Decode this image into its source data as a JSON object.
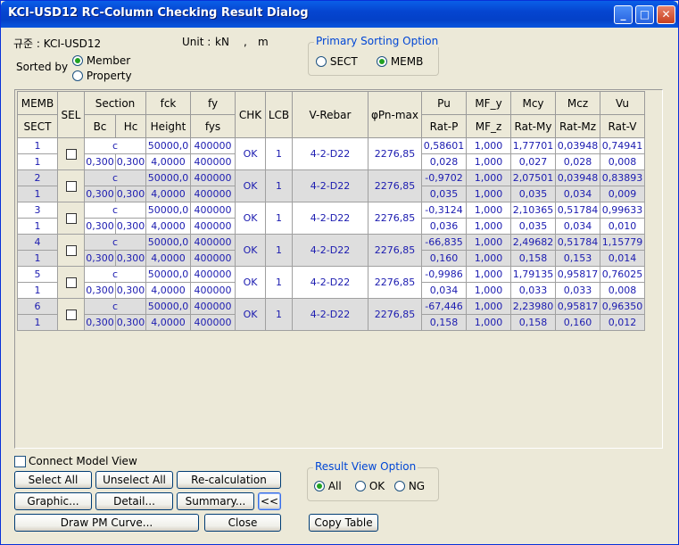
{
  "window": {
    "title": "KCI-USD12 RC-Column Checking Result Dialog",
    "min_icon": "minimize-icon",
    "max_icon": "maximize-icon",
    "close_icon": "close-icon"
  },
  "info": {
    "code_label": "규준 : KCI-USD12",
    "unit_label": "Unit :",
    "unit_force": "kN",
    "unit_sep": ",",
    "unit_length": "m"
  },
  "sorted_by": {
    "label": "Sorted by",
    "options": [
      {
        "label": "Member",
        "selected": true
      },
      {
        "label": "Property",
        "selected": false
      }
    ]
  },
  "primary_sorting": {
    "title": "Primary Sorting Option",
    "options": [
      {
        "label": "SECT",
        "selected": false
      },
      {
        "label": "MEMB",
        "selected": true
      }
    ]
  },
  "table": {
    "headers_top": [
      "MEMB",
      "SEL",
      "Section",
      "fck",
      "fy",
      "CHK",
      "LCB",
      "V-Rebar",
      "φPn-max",
      "Pu",
      "MF_y",
      "Mcy",
      "Mcz",
      "Vu"
    ],
    "headers_bottom": [
      "SECT",
      "Bc",
      "Hc",
      "Height",
      "fys",
      "Rat-P",
      "MF_z",
      "Rat-My",
      "Rat-Mz",
      "Rat-V"
    ],
    "rows": [
      {
        "memb": "1",
        "sect": "1",
        "shape": "c",
        "bc": "0,300",
        "hc": "0,300",
        "fck": "50000,0",
        "height": "4,0000",
        "fy": "400000",
        "fys": "400000",
        "chk": "OK",
        "lcb": "1",
        "rebar": "4-2-D22",
        "pn": "2276,85",
        "pu": "0,58601",
        "ratp": "0,028",
        "mfy": "1,000",
        "mfz": "1,000",
        "mcy": "1,77701",
        "ratmy": "0,027",
        "mcz": "0,03948",
        "ratmz": "0,028",
        "vu": "0,74941",
        "ratv": "0,008"
      },
      {
        "memb": "2",
        "sect": "1",
        "shape": "c",
        "bc": "0,300",
        "hc": "0,300",
        "fck": "50000,0",
        "height": "4,0000",
        "fy": "400000",
        "fys": "400000",
        "chk": "OK",
        "lcb": "1",
        "rebar": "4-2-D22",
        "pn": "2276,85",
        "pu": "-0,9702",
        "ratp": "0,035",
        "mfy": "1,000",
        "mfz": "1,000",
        "mcy": "2,07501",
        "ratmy": "0,035",
        "mcz": "0,03948",
        "ratmz": "0,034",
        "vu": "0,83893",
        "ratv": "0,009"
      },
      {
        "memb": "3",
        "sect": "1",
        "shape": "c",
        "bc": "0,300",
        "hc": "0,300",
        "fck": "50000,0",
        "height": "4,0000",
        "fy": "400000",
        "fys": "400000",
        "chk": "OK",
        "lcb": "1",
        "rebar": "4-2-D22",
        "pn": "2276,85",
        "pu": "-0,3124",
        "ratp": "0,036",
        "mfy": "1,000",
        "mfz": "1,000",
        "mcy": "2,10365",
        "ratmy": "0,035",
        "mcz": "0,51784",
        "ratmz": "0,034",
        "vu": "0,99633",
        "ratv": "0,010"
      },
      {
        "memb": "4",
        "sect": "1",
        "shape": "c",
        "bc": "0,300",
        "hc": "0,300",
        "fck": "50000,0",
        "height": "4,0000",
        "fy": "400000",
        "fys": "400000",
        "chk": "OK",
        "lcb": "1",
        "rebar": "4-2-D22",
        "pn": "2276,85",
        "pu": "-66,835",
        "ratp": "0,160",
        "mfy": "1,000",
        "mfz": "1,000",
        "mcy": "2,49682",
        "ratmy": "0,158",
        "mcz": "0,51784",
        "ratmz": "0,153",
        "vu": "1,15779",
        "ratv": "0,014"
      },
      {
        "memb": "5",
        "sect": "1",
        "shape": "c",
        "bc": "0,300",
        "hc": "0,300",
        "fck": "50000,0",
        "height": "4,0000",
        "fy": "400000",
        "fys": "400000",
        "chk": "OK",
        "lcb": "1",
        "rebar": "4-2-D22",
        "pn": "2276,85",
        "pu": "-0,9986",
        "ratp": "0,034",
        "mfy": "1,000",
        "mfz": "1,000",
        "mcy": "1,79135",
        "ratmy": "0,033",
        "mcz": "0,95817",
        "ratmz": "0,033",
        "vu": "0,76025",
        "ratv": "0,008"
      },
      {
        "memb": "6",
        "sect": "1",
        "shape": "c",
        "bc": "0,300",
        "hc": "0,300",
        "fck": "50000,0",
        "height": "4,0000",
        "fy": "400000",
        "fys": "400000",
        "chk": "OK",
        "lcb": "1",
        "rebar": "4-2-D22",
        "pn": "2276,85",
        "pu": "-67,446",
        "ratp": "0,158",
        "mfy": "1,000",
        "mfz": "1,000",
        "mcy": "2,23980",
        "ratmy": "0,158",
        "mcz": "0,95817",
        "ratmz": "0,160",
        "vu": "0,96350",
        "ratv": "0,012"
      }
    ]
  },
  "connect_model_view": {
    "label": "Connect Model View",
    "checked": false
  },
  "buttons": {
    "select_all": "Select All",
    "unselect_all": "Unselect All",
    "recalculation": "Re-calculation",
    "graphic": "Graphic...",
    "detail": "Detail...",
    "summary": "Summary...",
    "collapse": "<<",
    "draw_pm": "Draw PM Curve...",
    "close": "Close",
    "copy_table": "Copy Table"
  },
  "result_view": {
    "title": "Result View Option",
    "options": [
      {
        "label": "All",
        "selected": true
      },
      {
        "label": "OK",
        "selected": false
      },
      {
        "label": "NG",
        "selected": false
      }
    ]
  },
  "colors": {
    "title_bar": "#0545d0",
    "value_text": "#1b1bb0",
    "group_title": "#0046d5",
    "dark_row": "#dedede"
  }
}
